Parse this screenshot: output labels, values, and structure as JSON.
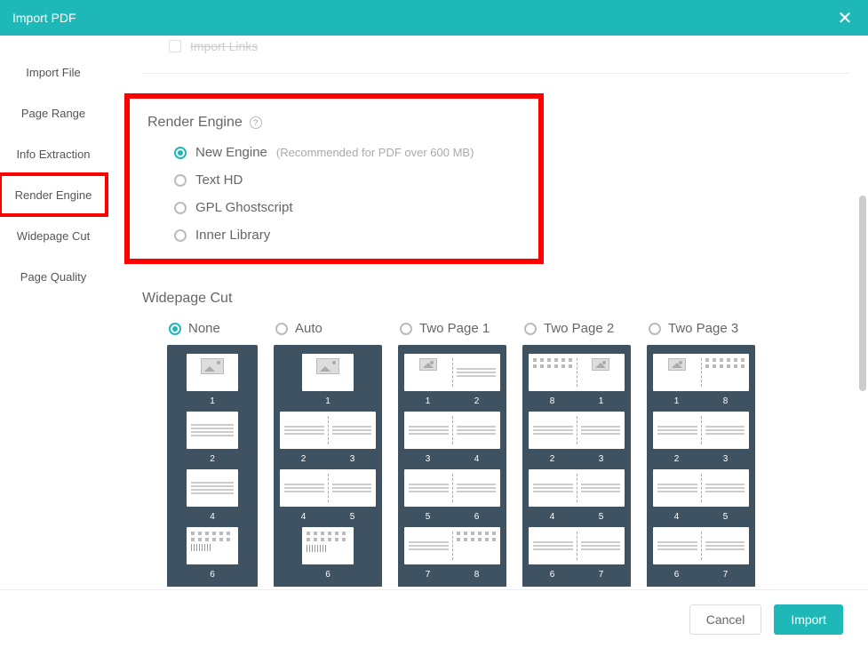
{
  "titlebar": {
    "title": "Import PDF"
  },
  "sidebar": {
    "items": [
      {
        "label": "Import File"
      },
      {
        "label": "Page Range"
      },
      {
        "label": "Info Extraction"
      },
      {
        "label": "Render Engine"
      },
      {
        "label": "Widepage Cut"
      },
      {
        "label": "Page Quality"
      }
    ]
  },
  "importLinks": {
    "label": "Import Links"
  },
  "renderEngine": {
    "title": "Render Engine",
    "options": [
      {
        "label": "New Engine",
        "hint": "(Recommended for PDF over 600 MB)",
        "selected": true
      },
      {
        "label": "Text HD",
        "selected": false
      },
      {
        "label": "GPL Ghostscript",
        "selected": false
      },
      {
        "label": "Inner Library",
        "selected": false
      }
    ]
  },
  "widepage": {
    "title": "Widepage Cut",
    "options": [
      {
        "label": "None",
        "selected": true,
        "pages": [
          "1",
          "2",
          "4",
          "6"
        ]
      },
      {
        "label": "Auto",
        "selected": false,
        "pages": [
          "1",
          "2",
          "3",
          "4",
          "5",
          "6"
        ]
      },
      {
        "label": "Two Page 1",
        "selected": false,
        "pages": [
          "1",
          "2",
          "3",
          "4",
          "5",
          "6",
          "7",
          "8"
        ]
      },
      {
        "label": "Two Page 2",
        "selected": false,
        "pages": [
          "8",
          "1",
          "2",
          "3",
          "4",
          "5",
          "6",
          "7"
        ]
      },
      {
        "label": "Two Page 3",
        "selected": false,
        "pages": [
          "1",
          "8",
          "2",
          "3",
          "4",
          "5",
          "6",
          "7"
        ]
      }
    ]
  },
  "footer": {
    "cancel": "Cancel",
    "import": "Import"
  }
}
